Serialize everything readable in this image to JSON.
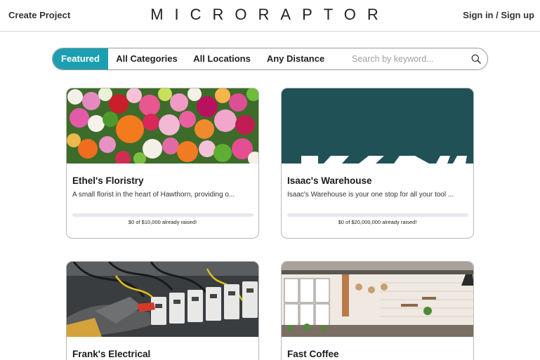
{
  "header": {
    "create_project": "Create Project",
    "logo": "MICRORAPTOR",
    "auth": "Sign in / Sign up"
  },
  "filters": {
    "featured": "Featured",
    "all_categories": "All Categories",
    "all_locations": "All Locations",
    "any_distance": "Any Distance",
    "search_placeholder": "Search by keyword...",
    "accent_color": "#1b9fb1"
  },
  "projects": [
    {
      "title": "Ethel's Floristry",
      "description": "A small florist in the heart of Hawthorn, providing o...",
      "raised_text": "$0 of $10,000 already raised!",
      "progress": 0,
      "image": "flowers-photo"
    },
    {
      "title": "Isaac's Warehouse",
      "description": "Isaac's Warehouse is your one stop for all your tool ...",
      "raised_text": "$0 of $20,000,000 already raised!",
      "progress": 0,
      "image": "warehouse-logo"
    },
    {
      "title": "Frank's Electrical",
      "image": "electrician-photo"
    },
    {
      "title": "Fast Coffee",
      "image": "cafe-interior-photo"
    }
  ]
}
